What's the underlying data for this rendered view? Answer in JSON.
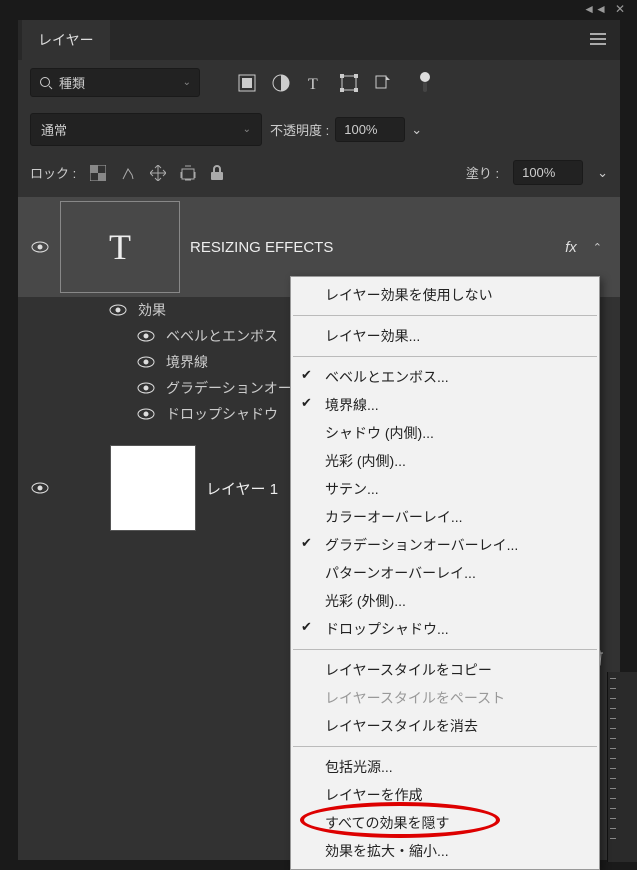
{
  "panel": {
    "title": "レイヤー",
    "search_label": "種類",
    "blend_mode": "通常",
    "opacity_label": "不透明度 :",
    "opacity_value": "100%",
    "lock_label": "ロック :",
    "fill_label": "塗り :",
    "fill_value": "100%"
  },
  "layers": {
    "text_layer": {
      "name": "RESIZING EFFECTS",
      "thumb_letter": "T",
      "fx_label": "fx"
    },
    "effects_header": "効果",
    "effects": {
      "e0": "ベベルとエンボス",
      "e1": "境界線",
      "e2": "グラデーションオーバ",
      "e3": "ドロップシャドウ"
    },
    "layer1": {
      "name": "レイヤー 1"
    }
  },
  "menu": {
    "m0": "レイヤー効果を使用しない",
    "m1": "レイヤー効果...",
    "m2": "ベベルとエンボス...",
    "m3": "境界線...",
    "m4": "シャドウ (内側)...",
    "m5": "光彩 (内側)...",
    "m6": "サテン...",
    "m7": "カラーオーバーレイ...",
    "m8": "グラデーションオーバーレイ...",
    "m9": "パターンオーバーレイ...",
    "m10": "光彩 (外側)...",
    "m11": "ドロップシャドウ...",
    "m12": "レイヤースタイルをコピー",
    "m13": "レイヤースタイルをペースト",
    "m14": "レイヤースタイルを消去",
    "m15": "包括光源...",
    "m16": "レイヤーを作成",
    "m17": "すべての効果を隠す",
    "m18": "効果を拡大・縮小..."
  }
}
